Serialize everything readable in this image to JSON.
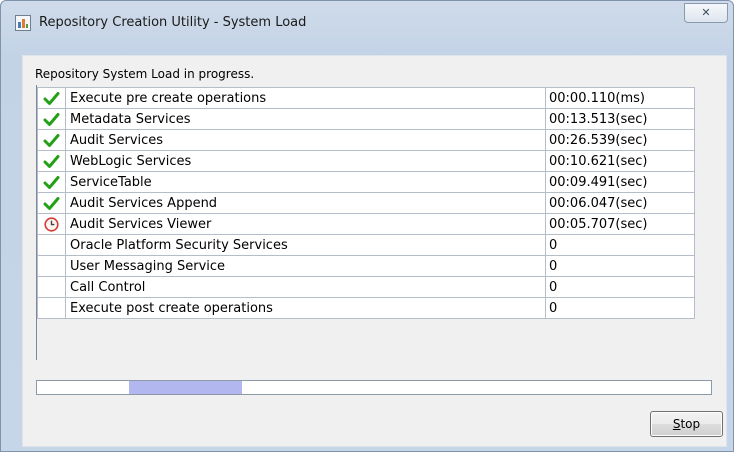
{
  "window": {
    "title": "Repository Creation Utility - System Load",
    "close_glyph": "✕"
  },
  "status_message": "Repository System Load in progress.",
  "tasks": [
    {
      "name": "Execute pre create operations",
      "time": "00:00.110(ms)",
      "state": "done"
    },
    {
      "name": "Metadata Services",
      "time": "00:13.513(sec)",
      "state": "done"
    },
    {
      "name": "Audit Services",
      "time": "00:26.539(sec)",
      "state": "done"
    },
    {
      "name": "WebLogic Services",
      "time": "00:10.621(sec)",
      "state": "done"
    },
    {
      "name": "ServiceTable",
      "time": "00:09.491(sec)",
      "state": "done"
    },
    {
      "name": "Audit Services Append",
      "time": "00:06.047(sec)",
      "state": "done"
    },
    {
      "name": "Audit Services Viewer",
      "time": "00:05.707(sec)",
      "state": "running"
    },
    {
      "name": "Oracle Platform Security Services",
      "time": "0",
      "state": "pending"
    },
    {
      "name": "User Messaging Service",
      "time": "0",
      "state": "pending"
    },
    {
      "name": "Call Control",
      "time": "0",
      "state": "pending"
    },
    {
      "name": "Execute post create operations",
      "time": "0",
      "state": "pending"
    }
  ],
  "icons": {
    "done": "checkmark-icon",
    "running": "clock-icon",
    "pending": "none"
  },
  "colors": {
    "check": "#22a016",
    "clock": "#d23b36",
    "progress_fill": "#b2b7f0"
  },
  "progress": {
    "style": "indeterminate",
    "segment_start": 0.137,
    "segment_width": 0.167
  },
  "buttons": {
    "stop": "Stop"
  }
}
